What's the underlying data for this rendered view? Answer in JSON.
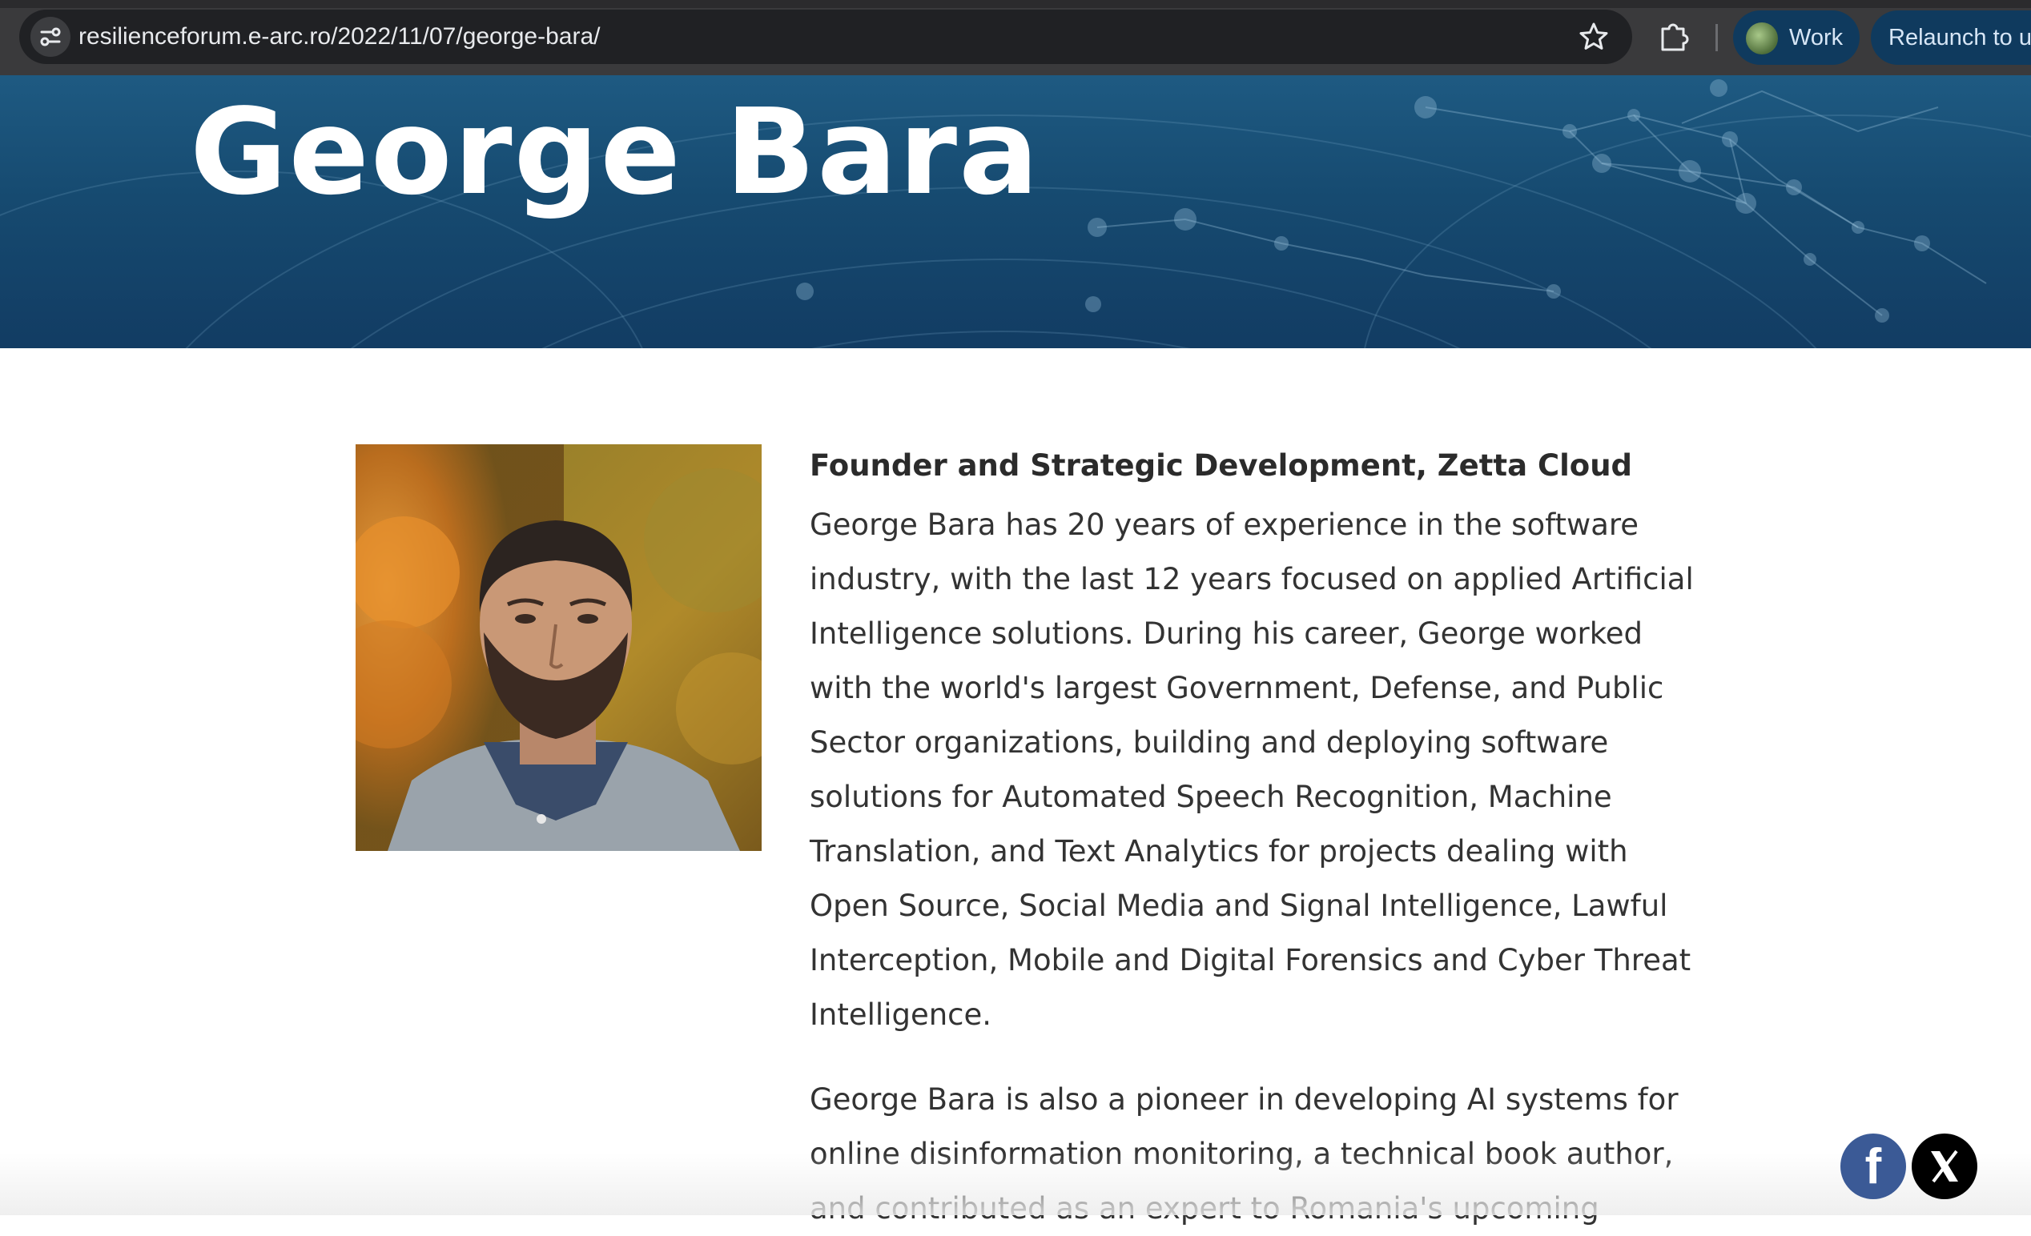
{
  "browser": {
    "url": "resilienceforum.e-arc.ro/2022/11/07/george-bara/",
    "profile_label": "Work",
    "relaunch_label": "Relaunch to up"
  },
  "hero": {
    "title": "George Bara"
  },
  "profile": {
    "photo_alt": "George Bara portrait",
    "role": "Founder and Strategic Development, Zetta Cloud",
    "bio_paragraph_1": [
      "George Bara has 20 years of experience in the software",
      "industry, with the last 12 years focused on applied Artificial",
      "Intelligence solutions. During his career, George worked",
      "with the world's largest Government, Defense, and Public",
      "Sector organizations, building and deploying software",
      "solutions for Automated Speech Recognition, Machine",
      "Translation, and Text Analytics for projects dealing with",
      "Open Source, Social Media and Signal Intelligence, Lawful",
      "Interception, Mobile and Digital Forensics and Cyber Threat",
      "Intelligence."
    ],
    "bio_paragraph_2": [
      "George Bara is also a pioneer in developing AI systems for",
      "online disinformation monitoring, a technical book author,",
      "and contributed as an expert to Romania's upcoming"
    ]
  },
  "share": {
    "facebook_icon": "facebook-icon",
    "x_icon": "x-logo-icon"
  }
}
